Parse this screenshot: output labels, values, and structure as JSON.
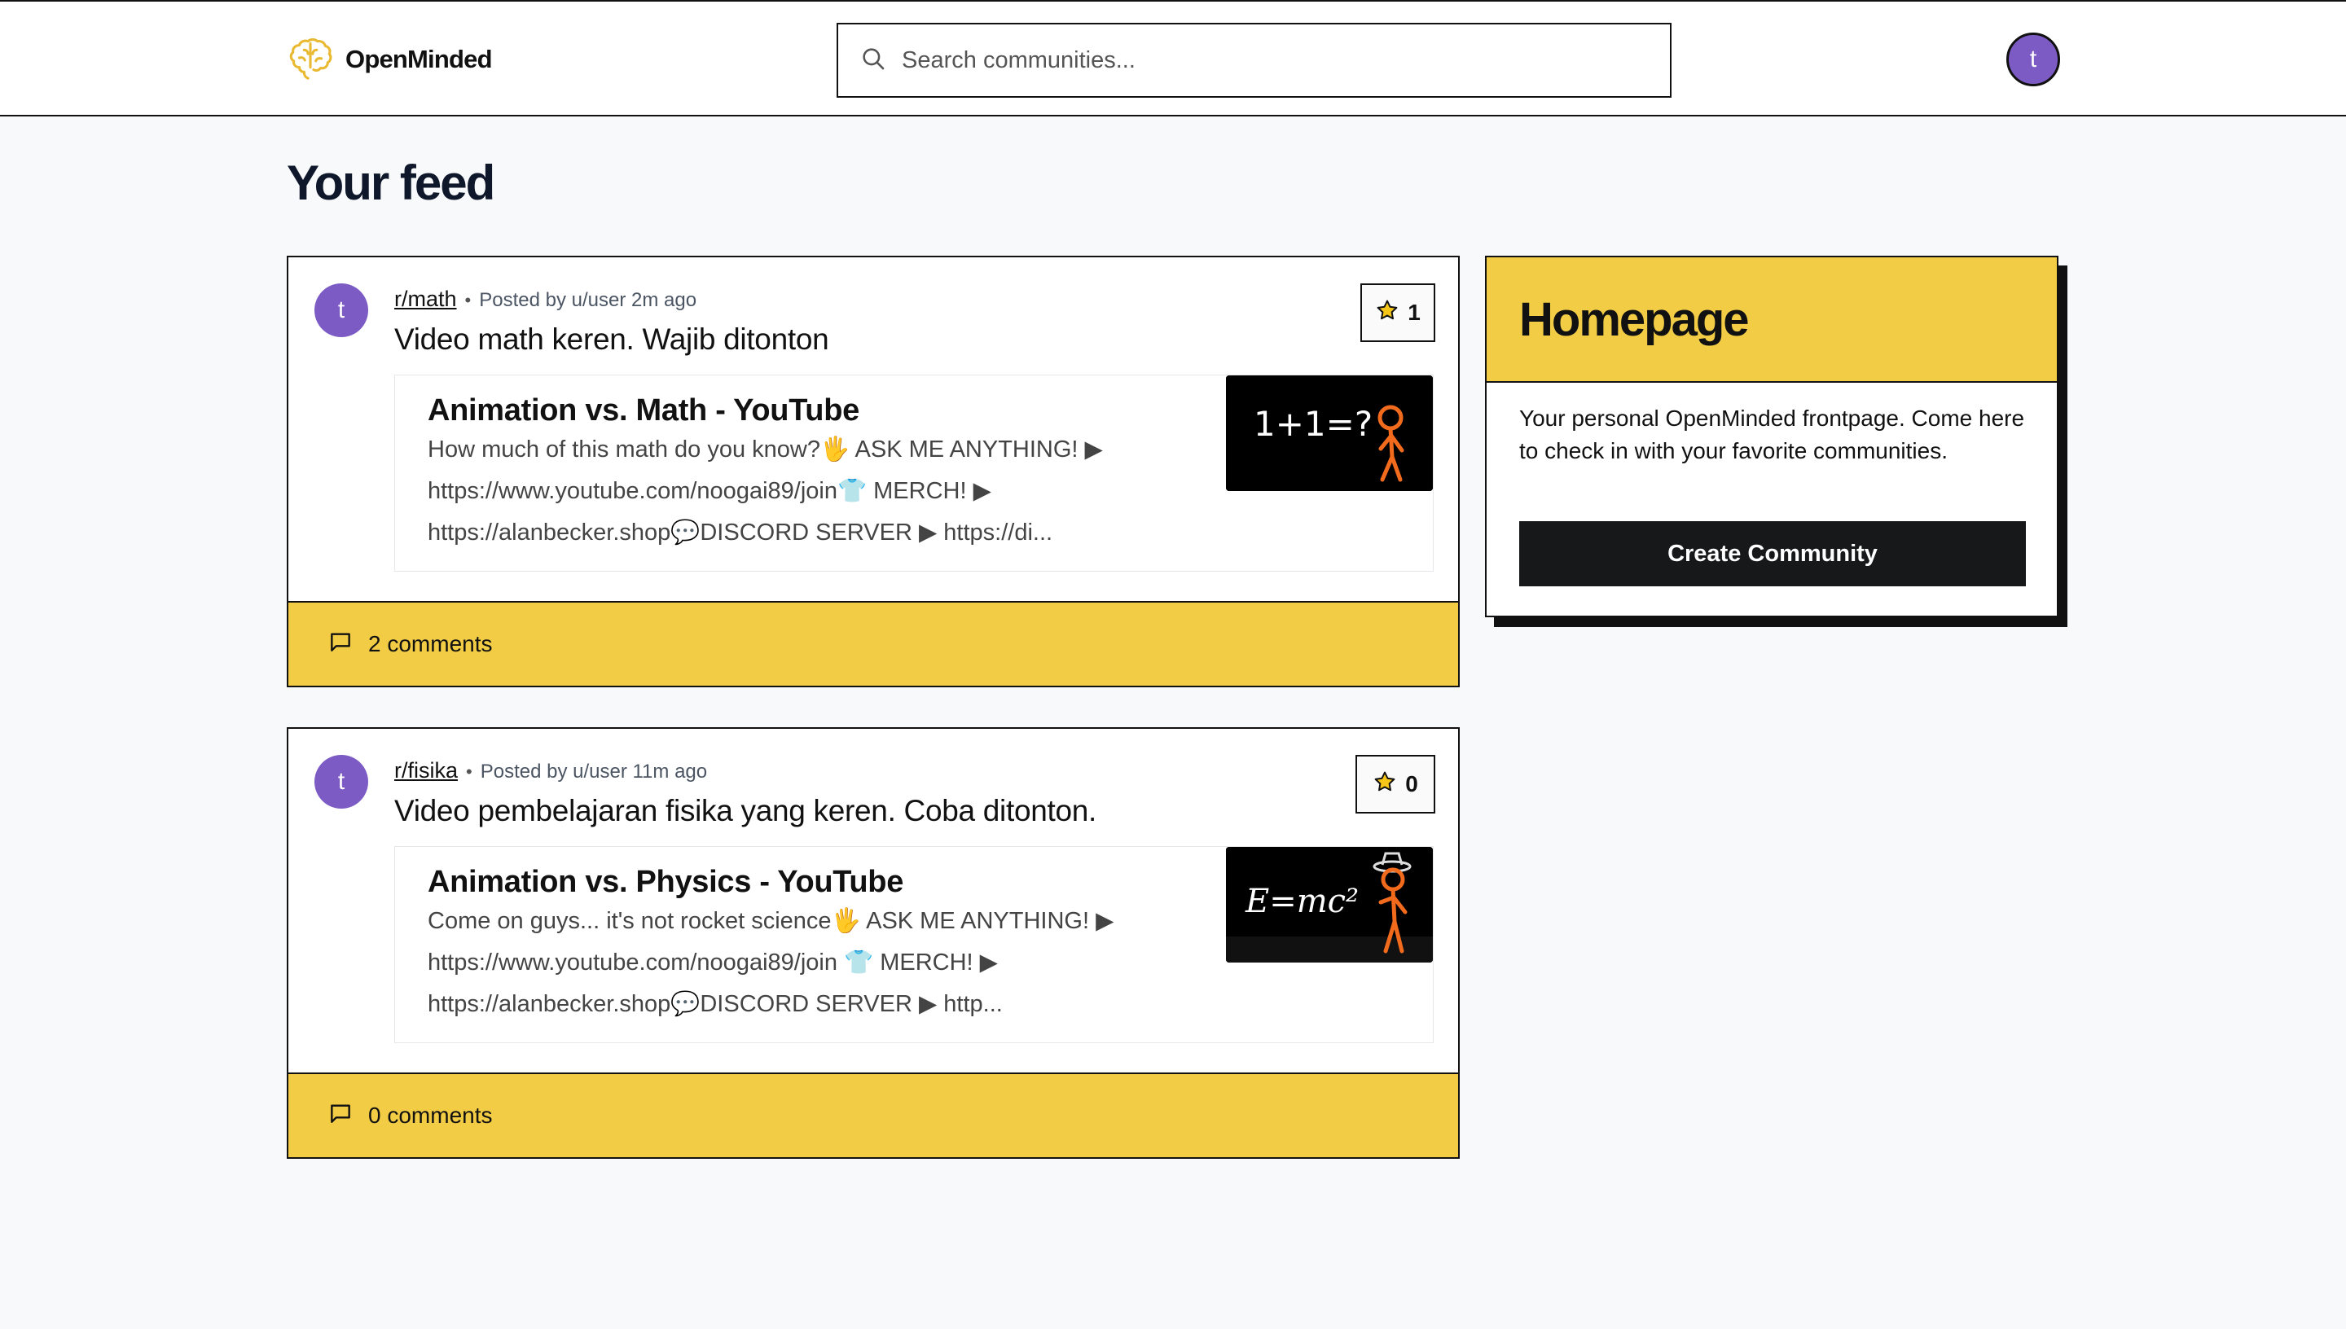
{
  "header": {
    "brand": "OpenMinded",
    "search_placeholder": "Search communities...",
    "avatar_initial": "t"
  },
  "page": {
    "title": "Your feed"
  },
  "feed": [
    {
      "avatar_initial": "t",
      "subreddit": "r/math",
      "posted_by": "Posted by u/user 2m ago",
      "title": "Video math keren. Wajib ditonton",
      "votes": "1",
      "embed": {
        "title": "Animation vs. Math - YouTube",
        "description": "How much of this math do you know?🖐 ASK ME ANYTHING! ▶ https://www.youtube.com/noogai89/join👕 MERCH! ▶ https://alanbecker.shop💬DISCORD SERVER ▶ https://di...",
        "thumbnail_text": "1+1=?"
      },
      "comments": "2 comments"
    },
    {
      "avatar_initial": "t",
      "subreddit": "r/fisika",
      "posted_by": "Posted by u/user 11m ago",
      "title": "Video pembelajaran fisika yang keren. Coba ditonton.",
      "votes": "0",
      "embed": {
        "title": "Animation vs. Physics - YouTube",
        "description": "Come on guys... it's not rocket science🖐 ASK ME ANYTHING! ▶ https://www.youtube.com/noogai89/join 👕 MERCH! ▶ https://alanbecker.shop💬DISCORD SERVER ▶ http...",
        "thumbnail_text": "E=mc²"
      },
      "comments": "0 comments"
    }
  ],
  "sidebar": {
    "title": "Homepage",
    "description": "Your personal OpenMinded frontpage. Come here to check in with your favorite communities.",
    "create_button": "Create Community"
  },
  "colors": {
    "accent_yellow": "#f2cc45",
    "avatar_purple": "#7c5cc4",
    "border": "#111111",
    "background": "#f8f9fb",
    "stick_figure_orange": "#f26b1d"
  },
  "icons": {
    "logo": "brain-icon",
    "search": "search-icon",
    "vote": "star-icon",
    "comments": "comment-icon"
  }
}
